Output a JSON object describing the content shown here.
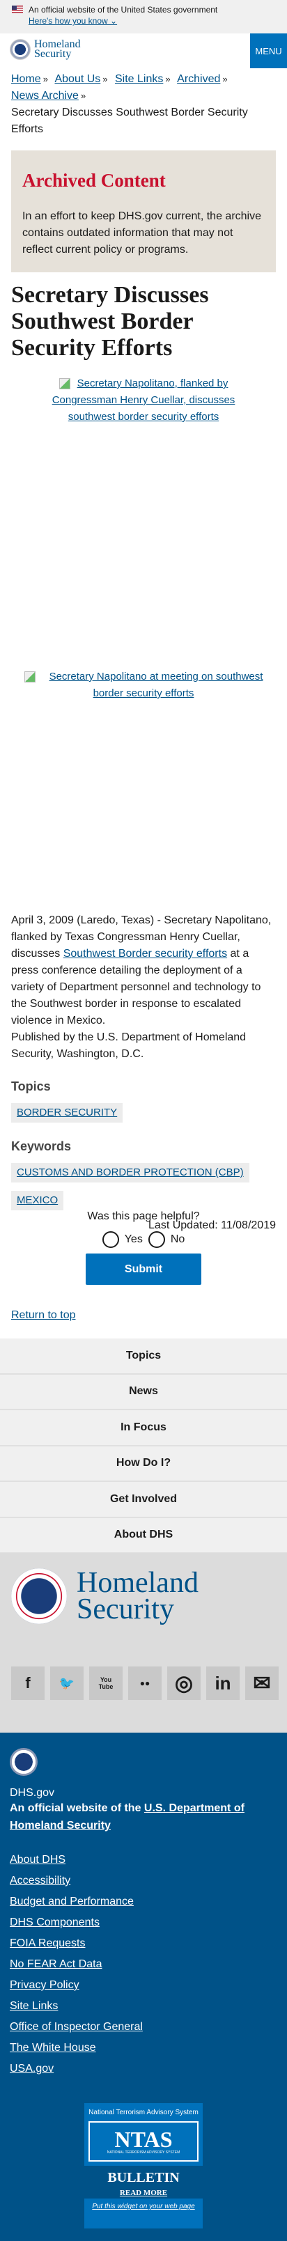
{
  "gov_banner": {
    "text": "An official website of the United States government",
    "link": "Here's how you know ⌄"
  },
  "header": {
    "logo_line1": "Homeland",
    "logo_line2": "Security",
    "menu": "MENU"
  },
  "breadcrumb": {
    "items": [
      "Home",
      "About Us",
      "Site Links",
      "Archived",
      "News Archive"
    ],
    "current": "Secretary Discusses Southwest Border Security Efforts",
    "sep": "»"
  },
  "archived": {
    "title": "Archived Content",
    "text": "In an effort to keep DHS.gov current, the archive contains outdated information that may not reflect current policy or programs."
  },
  "title": "Secretary Discusses Southwest Border Security Efforts",
  "images": [
    "Secretary Napolitano, flanked by Congressman Henry Cuellar, discusses southwest border security efforts",
    "Secretary Napolitano at meeting on southwest border security efforts"
  ],
  "body": {
    "p1_before": "April 3, 2009 (Laredo, Texas) - Secretary Napolitano, flanked by Texas Congressman Henry Cuellar, discusses ",
    "p1_link": "Southwest Border security efforts",
    "p1_after": " at a press conference detailing the deployment of a variety of Department personnel and technology to the Southwest border in response to escalated violence in Mexico.",
    "p2": "Published by the U.S. Department of Homeland Security, Washington, D.C."
  },
  "topics": {
    "heading": "Topics",
    "tags": [
      "BORDER SECURITY"
    ]
  },
  "keywords": {
    "heading": "Keywords",
    "tags": [
      "CUSTOMS AND BORDER PROTECTION (CBP)",
      "MEXICO"
    ]
  },
  "last_updated": "Last Updated: 11/08/2019",
  "feedback": {
    "question": "Was this page helpful?",
    "yes": "Yes",
    "no": "No",
    "submit": "Submit"
  },
  "return_top": "Return to top",
  "nav": [
    "Topics",
    "News",
    "In Focus",
    "How Do I?",
    "Get Involved",
    "About DHS"
  ],
  "social": {
    "facebook": "f",
    "twitter": "🐦",
    "youtube": "You Tube",
    "flickr": "●●",
    "instagram": "◎",
    "linkedin": "in",
    "email": "✉"
  },
  "footer": {
    "site": "DHS.gov",
    "official_prefix": "An official website of the ",
    "official_link": "U.S. Department of Homeland Security",
    "links": [
      "About DHS",
      "Accessibility",
      "Budget and Performance",
      "DHS Components",
      "FOIA Requests",
      "No FEAR Act Data",
      "Privacy Policy",
      "Site Links",
      "Office of Inspector General",
      "The White House",
      "USA.gov"
    ]
  },
  "ntas": {
    "title": "National Terrorism Advisory System",
    "logo": "NTAS",
    "logo_sub": "NATIONAL TERRORISM ADVISORY SYSTEM",
    "bulletin": "BULLETIN",
    "read_more": "READ MORE",
    "widget": "Put this widget on your web page"
  }
}
